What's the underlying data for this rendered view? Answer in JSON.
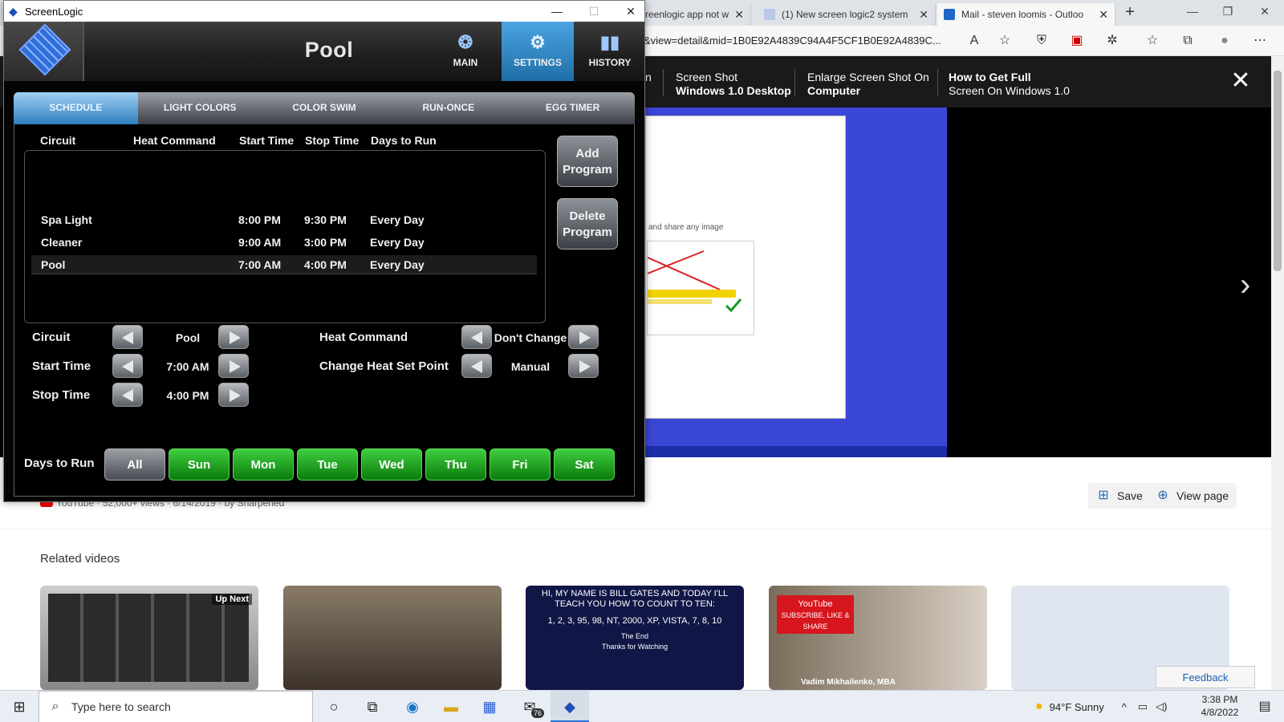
{
  "browser": {
    "tabs": [
      {
        "title": "creenlogic app not w"
      },
      {
        "title": "(1) New screen logic2 system"
      },
      {
        "title": "Mail - steven loomis - Outloo"
      }
    ],
    "url": "&view=detail&mid=1B0E92A4839C94A4F5CF1B0E92A4839C...",
    "filmstrip": [
      {
        "line1": "n",
        "line2": ""
      },
      {
        "line1": "Screen Shot",
        "line2": "Windows 1.0 Desktop"
      },
      {
        "line1": "Enlarge Screen Shot On",
        "line2": "Computer"
      },
      {
        "line1": "How to Get Full",
        "line2": "Screen On Windows 1.0"
      }
    ],
    "preview_text": "and share any image",
    "save_label": "Save",
    "view_page_label": "View page",
    "source_line": "YouTube · 52,000+ views · 6/14/2019 · by Sharpened",
    "related_title": "Related videos",
    "up_next_label": "Up Next",
    "thumb3_text": "HI, MY NAME IS BILL GATES AND TODAY I'LL TEACH YOU HOW TO COUNT TO TEN:",
    "thumb3_count": "1, 2, 3, 95, 98, NT, 2000, XP, VISTA, 7, 8, 10",
    "thumb3_end": "The End",
    "thumb3_thanks": "Thanks for Watching",
    "thumb4_brand": "YouTube",
    "thumb4_sub": "SUBSCRIBE, LIKE & SHARE",
    "thumb4_name": "Vadim Mikhailenko, MBA",
    "feedback_label": "Feedback"
  },
  "screenlogic": {
    "window_title": "ScreenLogic",
    "page_title": "Pool",
    "nav": [
      {
        "label": "MAIN"
      },
      {
        "label": "SETTINGS"
      },
      {
        "label": "HISTORY"
      }
    ],
    "tabs": [
      "SCHEDULE",
      "LIGHT COLORS",
      "COLOR SWIM",
      "RUN-ONCE",
      "EGG TIMER"
    ],
    "active_tab": "SCHEDULE",
    "columns": {
      "circuit": "Circuit",
      "heat_command": "Heat Command",
      "start_time": "Start Time",
      "stop_time": "Stop Time",
      "days_to_run": "Days to Run"
    },
    "schedule": [
      {
        "circuit": "Spa Light",
        "heat": "",
        "start": "8:00  PM",
        "stop": "9:30  PM",
        "days": "Every Day"
      },
      {
        "circuit": "Cleaner",
        "heat": "",
        "start": "9:00  AM",
        "stop": "3:00  PM",
        "days": "Every Day"
      },
      {
        "circuit": "Pool",
        "heat": "",
        "start": "7:00  AM",
        "stop": "4:00  PM",
        "days": "Every Day"
      }
    ],
    "add_program": [
      "Add",
      "Program"
    ],
    "delete_program": [
      "Delete",
      "Program"
    ],
    "editor": {
      "circuit_label": "Circuit",
      "circuit_value": "Pool",
      "start_label": "Start Time",
      "start_value": "7:00  AM",
      "stop_label": "Stop Time",
      "stop_value": "4:00  PM",
      "heat_command_label": "Heat Command",
      "heat_command_value": "Don't Change",
      "heat_setpoint_label": "Change Heat Set Point",
      "heat_setpoint_value": "Manual"
    },
    "days_label": "Days to Run",
    "days": [
      "All",
      "Sun",
      "Mon",
      "Tue",
      "Wed",
      "Thu",
      "Fri",
      "Sat"
    ]
  },
  "taskbar": {
    "search_placeholder": "Type here to search",
    "mail_badge": "76",
    "weather": "94°F  Sunny",
    "time": "3:38 PM",
    "date": "4/8/2022"
  },
  "colors": {
    "accent_blue": "#2d7fc0",
    "day_green": "#1fa81f",
    "panel_black": "#000000"
  }
}
